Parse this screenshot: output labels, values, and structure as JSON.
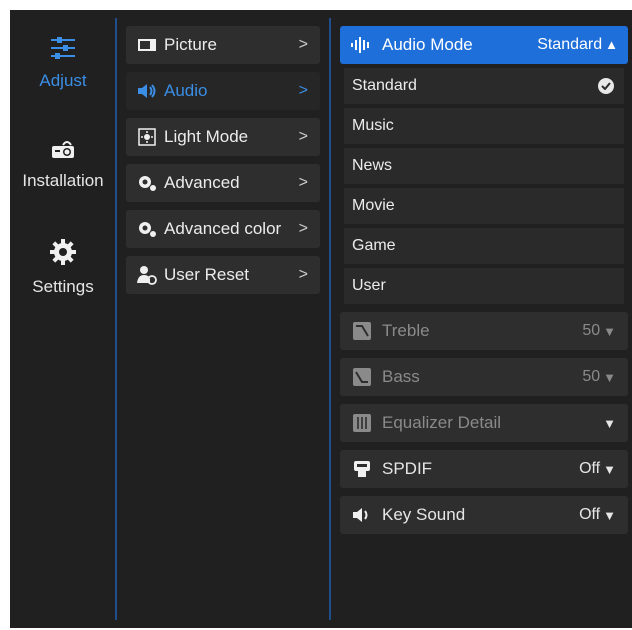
{
  "nav": {
    "items": [
      {
        "label": "Adjust",
        "icon": "sliders-icon",
        "active": true
      },
      {
        "label": "Installation",
        "icon": "projector-icon",
        "active": false
      },
      {
        "label": "Settings",
        "icon": "gear-icon",
        "active": false
      }
    ]
  },
  "menu": {
    "items": [
      {
        "label": "Picture",
        "icon": "picture-icon"
      },
      {
        "label": "Audio",
        "icon": "speaker-icon",
        "active": true
      },
      {
        "label": "Light Mode",
        "icon": "light-mode-icon"
      },
      {
        "label": "Advanced",
        "icon": "gears-icon"
      },
      {
        "label": "Advanced color",
        "icon": "color-gears-icon"
      },
      {
        "label": "User Reset",
        "icon": "user-reset-icon"
      }
    ],
    "chevron": ">"
  },
  "audio": {
    "mode_label": "Audio Mode",
    "mode_value": "Standard",
    "options": [
      "Standard",
      "Music",
      "News",
      "Movie",
      "Game",
      "User"
    ],
    "selected_option": "Standard",
    "treble": {
      "label": "Treble",
      "value": "50"
    },
    "bass": {
      "label": "Bass",
      "value": "50"
    },
    "equalizer": {
      "label": "Equalizer Detail"
    },
    "spdif": {
      "label": "SPDIF",
      "value": "Off"
    },
    "key_sound": {
      "label": "Key Sound",
      "value": "Off"
    }
  },
  "colors": {
    "accent": "#1e6fd9",
    "active_text": "#3a8ee6",
    "background": "#202020"
  }
}
